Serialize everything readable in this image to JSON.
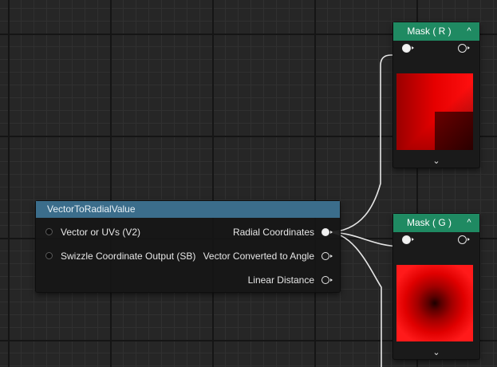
{
  "main_node": {
    "title": "VectorToRadialValue",
    "inputs": [
      "Vector or UVs (V2)",
      "Swizzle Coordinate Output (SB)"
    ],
    "outputs": [
      "Radial Coordinates",
      "Vector Converted to Angle",
      "Linear Distance"
    ]
  },
  "mask_r": {
    "title": "Mask ( R )",
    "collapse_icon": "chevron-up-icon",
    "expand_icon": "chevron-down-icon"
  },
  "mask_g": {
    "title": "Mask ( G )",
    "collapse_icon": "chevron-up-icon",
    "expand_icon": "chevron-down-icon"
  },
  "glyphs": {
    "up": "^",
    "down": "⌄"
  },
  "colors": {
    "graph_background": "#262626",
    "main_header": "#3b6d8b",
    "mask_header": "#1f8a62",
    "wire": "#e6e6e6"
  }
}
